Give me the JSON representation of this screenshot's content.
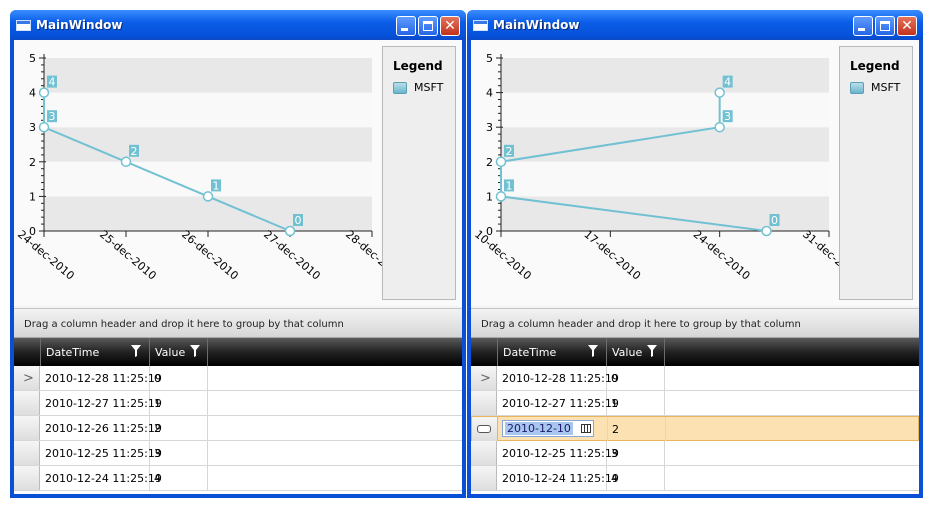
{
  "windows": [
    {
      "title": "MainWindow",
      "legend": {
        "title": "Legend",
        "series": "MSFT"
      },
      "group_hint": "Drag a column header and drop it here to group by that column",
      "columns": [
        "DateTime",
        "Value"
      ],
      "rows": [
        {
          "datetime": "2010-12-28 11:25:19",
          "value": "0",
          "state": "current"
        },
        {
          "datetime": "2010-12-27 11:25:19",
          "value": "1",
          "state": ""
        },
        {
          "datetime": "2010-12-26 11:25:19",
          "value": "2",
          "state": ""
        },
        {
          "datetime": "2010-12-25 11:25:19",
          "value": "3",
          "state": ""
        },
        {
          "datetime": "2010-12-24 11:25:19",
          "value": "4",
          "state": ""
        }
      ]
    },
    {
      "title": "MainWindow",
      "legend": {
        "title": "Legend",
        "series": "MSFT"
      },
      "group_hint": "Drag a column header and drop it here to group by that column",
      "columns": [
        "DateTime",
        "Value"
      ],
      "rows": [
        {
          "datetime": "2010-12-28 11:25:19",
          "value": "0",
          "state": "current"
        },
        {
          "datetime": "2010-12-27 11:25:19",
          "value": "1",
          "state": ""
        },
        {
          "datetime": "2010-12-10",
          "value": "2",
          "state": "editing"
        },
        {
          "datetime": "2010-12-25 11:25:19",
          "value": "3",
          "state": ""
        },
        {
          "datetime": "2010-12-24 11:25:19",
          "value": "4",
          "state": ""
        }
      ]
    }
  ],
  "chart_data": [
    {
      "type": "line",
      "xaxis": {
        "type": "date",
        "ticks": [
          "24-dec-2010",
          "25-dec-2010",
          "26-dec-2010",
          "27-dec-2010",
          "28-dec-2010"
        ],
        "xlim": [
          "2010-12-24",
          "2010-12-28"
        ]
      },
      "ylim": [
        0,
        5
      ],
      "yticks": [
        "0",
        "1",
        "2",
        "3",
        "4",
        "5"
      ],
      "series": [
        {
          "name": "MSFT",
          "color": "#72c1d3",
          "points": [
            {
              "x": "2010-12-24",
              "y": 4,
              "label": "4"
            },
            {
              "x": "2010-12-24",
              "y": 3,
              "label": "3"
            },
            {
              "x": "2010-12-25",
              "y": 2,
              "label": "2"
            },
            {
              "x": "2010-12-26",
              "y": 1,
              "label": "1"
            },
            {
              "x": "2010-12-27",
              "y": 0,
              "label": "0"
            }
          ]
        }
      ],
      "bands": "alternating grey horizontal bands"
    },
    {
      "type": "line",
      "xaxis": {
        "type": "date",
        "ticks": [
          "10-dec-2010",
          "17-dec-2010",
          "24-dec-2010",
          "31-dec-2010"
        ],
        "xlim": [
          "2010-12-10",
          "2010-12-31"
        ]
      },
      "ylim": [
        0,
        5
      ],
      "yticks": [
        "0",
        "1",
        "2",
        "3",
        "4",
        "5"
      ],
      "series": [
        {
          "name": "MSFT",
          "color": "#72c1d3",
          "points": [
            {
              "x": "2010-12-27",
              "y": 0,
              "label": "0"
            },
            {
              "x": "2010-12-10",
              "y": 1,
              "label": "1"
            },
            {
              "x": "2010-12-10",
              "y": 2,
              "label": "2"
            },
            {
              "x": "2010-12-24",
              "y": 3,
              "label": "3"
            },
            {
              "x": "2010-12-24",
              "y": 4,
              "label": "4"
            }
          ]
        }
      ],
      "bands": "alternating grey horizontal bands"
    }
  ]
}
